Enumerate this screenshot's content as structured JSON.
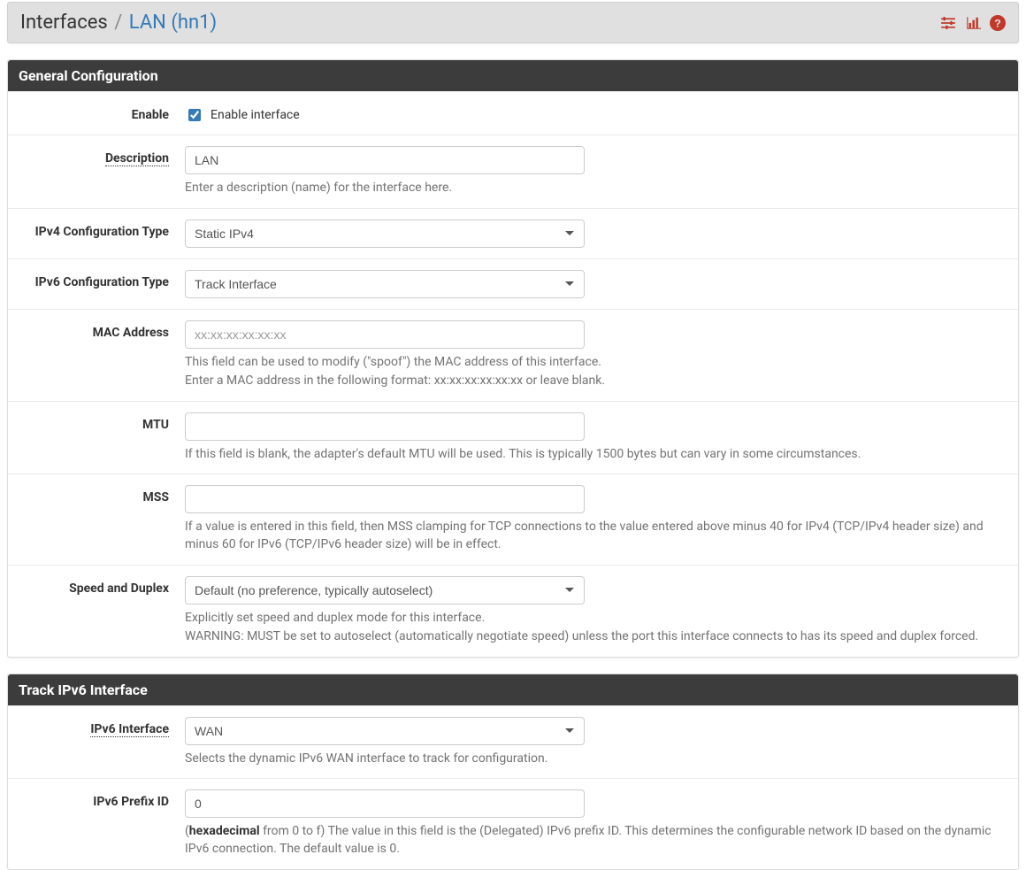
{
  "breadcrumb": {
    "root": "Interfaces",
    "separator": "/",
    "current": "LAN (hn1)"
  },
  "header_icons": {
    "sliders": "sliders-icon",
    "stats": "stats-icon",
    "help": "help-icon"
  },
  "panels": {
    "general": {
      "title": "General Configuration",
      "enable": {
        "label": "Enable",
        "checkbox_label": "Enable interface",
        "checked": true
      },
      "description": {
        "label": "Description",
        "value": "LAN",
        "help": "Enter a description (name) for the interface here."
      },
      "ipv4_type": {
        "label": "IPv4 Configuration Type",
        "value": "Static IPv4"
      },
      "ipv6_type": {
        "label": "IPv6 Configuration Type",
        "value": "Track Interface"
      },
      "mac": {
        "label": "MAC Address",
        "placeholder": "xx:xx:xx:xx:xx:xx",
        "value": "",
        "help1": "This field can be used to modify (\"spoof\") the MAC address of this interface.",
        "help2": "Enter a MAC address in the following format: xx:xx:xx:xx:xx:xx or leave blank."
      },
      "mtu": {
        "label": "MTU",
        "value": "",
        "help": "If this field is blank, the adapter's default MTU will be used. This is typically 1500 bytes but can vary in some circumstances."
      },
      "mss": {
        "label": "MSS",
        "value": "",
        "help": "If a value is entered in this field, then MSS clamping for TCP connections to the value entered above minus 40 for IPv4 (TCP/IPv4 header size) and minus 60 for IPv6 (TCP/IPv6 header size) will be in effect."
      },
      "speed": {
        "label": "Speed and Duplex",
        "value": "Default (no preference, typically autoselect)",
        "help1": "Explicitly set speed and duplex mode for this interface.",
        "help2": "WARNING: MUST be set to autoselect (automatically negotiate speed) unless the port this interface connects to has its speed and duplex forced."
      }
    },
    "track6": {
      "title": "Track IPv6 Interface",
      "ipv6_interface": {
        "label": "IPv6 Interface",
        "value": "WAN",
        "help": "Selects the dynamic IPv6 WAN interface to track for configuration."
      },
      "prefix_id": {
        "label": "IPv6 Prefix ID",
        "value": "0",
        "help_prefix": "(",
        "help_bold": "hexadecimal",
        "help_rest": " from 0 to f) The value in this field is the (Delegated) IPv6 prefix ID. This determines the configurable network ID based on the dynamic IPv6 connection. The default value is 0."
      }
    }
  }
}
